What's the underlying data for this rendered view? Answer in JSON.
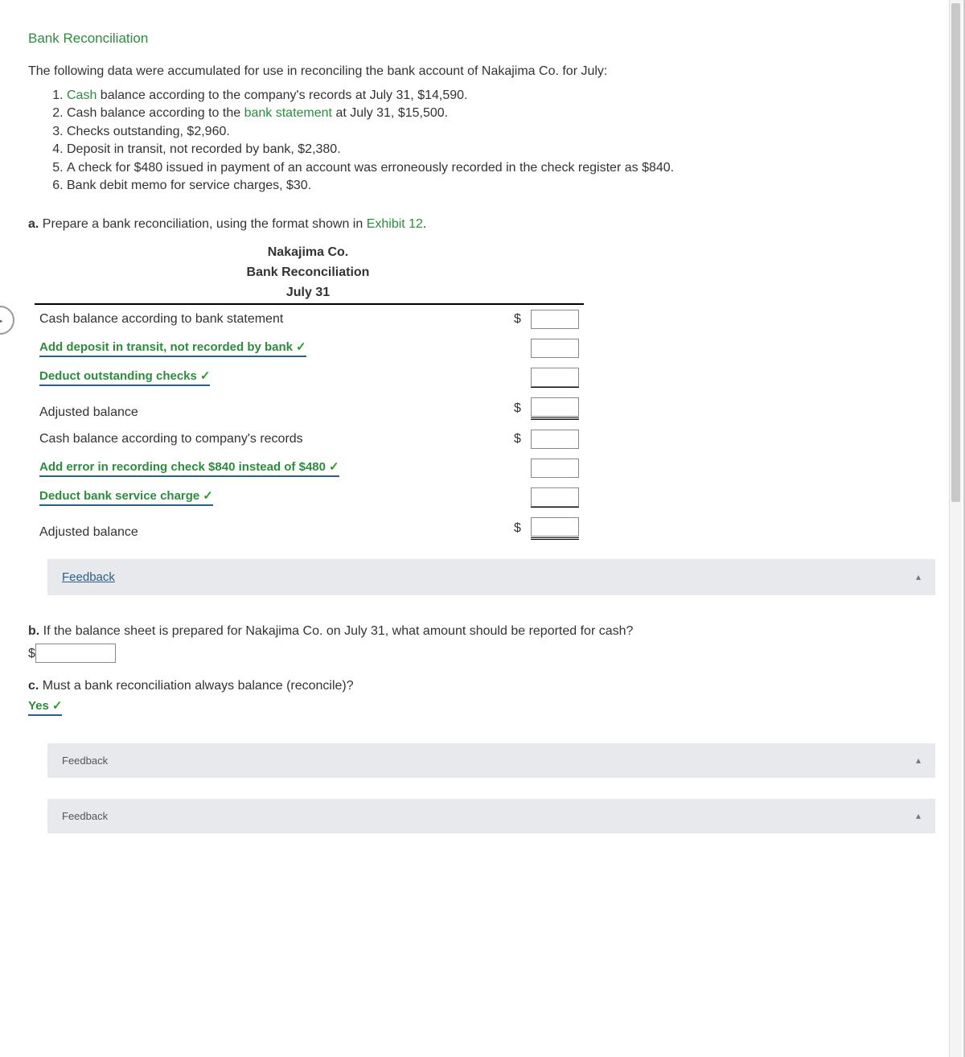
{
  "title": "Bank Reconciliation",
  "intro": "The following data were accumulated for use in reconciling the bank account of Nakajima Co. for July:",
  "data_items": {
    "i1_pre": "",
    "i1_link": "Cash",
    "i1_post": " balance according to the company's records at July 31, $14,590.",
    "i2_pre": "Cash balance according to the ",
    "i2_link": "bank statement",
    "i2_post": " at July 31, $15,500.",
    "i3": "Checks outstanding, $2,960.",
    "i4": "Deposit in transit, not recorded by bank, $2,380.",
    "i5": "A check for $480 issued in payment of an account was erroneously recorded in the check register as $840.",
    "i6": "Bank debit memo for service charges, $30."
  },
  "part_a": {
    "label": "a.",
    "text_pre": "  Prepare a bank reconciliation, using the format shown in ",
    "exhibit_link": "Exhibit 12",
    "text_post": "."
  },
  "recon": {
    "company": "Nakajima Co.",
    "title": "Bank Reconciliation",
    "date": "July 31",
    "rows": {
      "r1": "Cash balance according to bank statement",
      "r2": "Add deposit in transit, not recorded by bank",
      "r3": "Deduct outstanding checks",
      "r4": "Adjusted balance",
      "r5": "Cash balance according to company's records",
      "r6": "Add error in recording check $840 instead of $480",
      "r7": "Deduct bank service charge",
      "r8": "Adjusted balance"
    }
  },
  "feedback_label": "Feedback",
  "part_b": {
    "label": "b.",
    "text": "  If the balance sheet is prepared for Nakajima Co. on July 31, what amount should be reported for cash?"
  },
  "part_c": {
    "label": "c.",
    "text": "  Must a bank reconciliation always balance (reconcile)?",
    "answer": "Yes"
  },
  "dollar": "$",
  "check": "✓",
  "collapse_arrow": "▴",
  "nav_arrow": "▸"
}
